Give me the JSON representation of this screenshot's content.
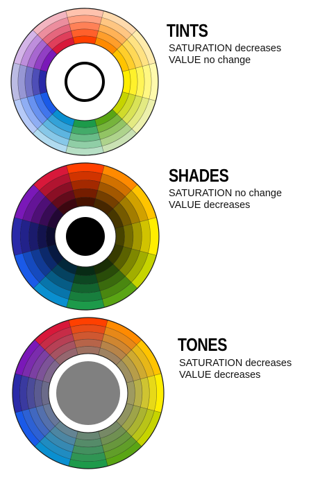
{
  "panels": [
    {
      "id": "tints",
      "title": "TINTS",
      "lines": [
        "SATURATION decreases",
        "VALUE no change"
      ],
      "mode": "tint",
      "center_fill": "#ffffff",
      "center_ring": "#000000"
    },
    {
      "id": "shades",
      "title": "SHADES",
      "lines": [
        "SATURATION no change",
        "VALUE decreases"
      ],
      "mode": "shade",
      "center_fill": "#000000",
      "center_ring": null
    },
    {
      "id": "tones",
      "title": "TONES",
      "lines": [
        "SATURATION decreases",
        "VALUE decreases"
      ],
      "mode": "tone",
      "center_fill": "#808080",
      "center_ring": null
    }
  ],
  "colors": {
    "hues": [
      "#ff4000",
      "#ff8a00",
      "#ffc400",
      "#ffee00",
      "#c6d400",
      "#5aa514",
      "#1d9a4a",
      "#0a8fd0",
      "#1a5ae8",
      "#2a2aa8",
      "#7a18b8",
      "#d8183a"
    ],
    "outline": "#1a1a1a",
    "background": "#ffffff"
  }
}
